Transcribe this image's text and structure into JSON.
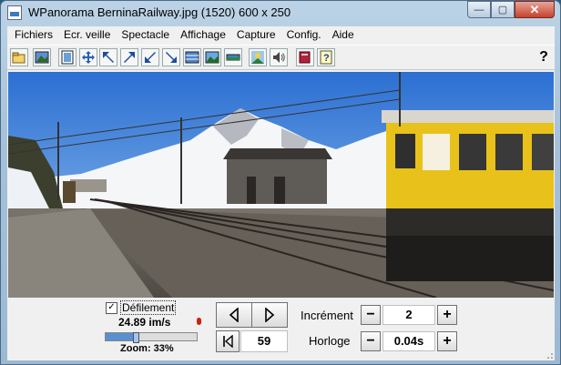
{
  "window": {
    "title": "WPanorama  BerninaRailway.jpg  (1520) 600 x 250",
    "buttons": {
      "minimize": "—",
      "maximize": "▢",
      "close": "✕"
    }
  },
  "menu": {
    "items": [
      "Fichiers",
      "Ecr. veille",
      "Spectacle",
      "Affichage",
      "Capture",
      "Config.",
      "Aide"
    ]
  },
  "toolbar": {
    "buttons": [
      "open-folder",
      "picture",
      "frame",
      "move",
      "arrow-upleft",
      "arrow-upright",
      "arrow-downleft",
      "arrow-downright",
      "grid-view",
      "landscape",
      "strip",
      "sun",
      "speaker",
      "book",
      "help-doc"
    ],
    "help_label": "?"
  },
  "controls": {
    "scroll_label": "Défilement",
    "scroll_checked": "✓",
    "speed": "24.89 im/s",
    "zoom": "Zoom: 33%",
    "zoom_fraction": 0.33,
    "frame": "59",
    "increment_label": "Incrément",
    "increment_value": "2",
    "clock_label": "Horloge",
    "clock_value": "0.04s",
    "minus": "−",
    "plus": "+"
  },
  "colors": {
    "accent": "#5a90cf",
    "tram": "#e8c21a"
  }
}
